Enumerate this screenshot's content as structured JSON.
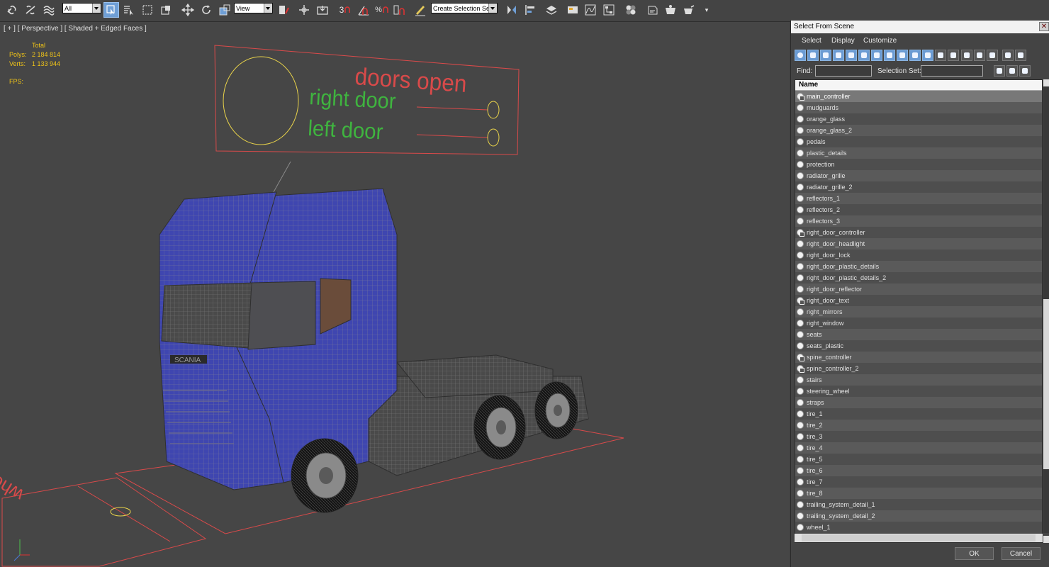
{
  "toolbar": {
    "filter_dropdown": "All",
    "ref_coord_dropdown": "View",
    "snap_labels": [
      "3",
      "%"
    ],
    "selection_set": "Create Selection Se"
  },
  "viewport": {
    "label": "[ + ] [ Perspective ] [ Shaded + Edged Faces ]",
    "stats_header": "Total",
    "polys_label": "Polys:",
    "polys_value": "2 184 814",
    "verts_label": "Verts:",
    "verts_value": "1 133 944",
    "fps_label": "FPS:",
    "annotation_doors_open": "doors open",
    "annotation_right_door": "right door",
    "annotation_left_door": "left door",
    "annotation_wheels": "wheels rotation",
    "truck_badge": "SCANIA",
    "colors": {
      "annotation_red": "#d94a4a",
      "annotation_green": "#3fb43f",
      "annotation_yellow": "#e9d34a",
      "truck_blue": "#4047b8"
    }
  },
  "dialog": {
    "title": "Select From Scene",
    "close_glyph": "✕",
    "menu": [
      "Select",
      "Display",
      "Customize"
    ],
    "find_label": "Find:",
    "selection_set_label": "Selection Set:",
    "column_header": "Name",
    "ok_label": "OK",
    "cancel_label": "Cancel",
    "rows": [
      {
        "name": "main_controller",
        "type": "controller",
        "selected": true
      },
      {
        "name": "mudguards",
        "type": "geometry"
      },
      {
        "name": "orange_glass",
        "type": "geometry"
      },
      {
        "name": "orange_glass_2",
        "type": "geometry"
      },
      {
        "name": "pedals",
        "type": "geometry"
      },
      {
        "name": "plastic_details",
        "type": "geometry"
      },
      {
        "name": "protection",
        "type": "geometry"
      },
      {
        "name": "radiator_grille",
        "type": "geometry"
      },
      {
        "name": "radiator_grille_2",
        "type": "geometry"
      },
      {
        "name": "reflectors_1",
        "type": "geometry"
      },
      {
        "name": "reflectors_2",
        "type": "geometry"
      },
      {
        "name": "reflectors_3",
        "type": "geometry"
      },
      {
        "name": "right_door_controller",
        "type": "controller"
      },
      {
        "name": "right_door_headlight",
        "type": "geometry"
      },
      {
        "name": "right_door_lock",
        "type": "geometry"
      },
      {
        "name": "right_door_plastic_details",
        "type": "geometry"
      },
      {
        "name": "right_door_plastic_details_2",
        "type": "geometry"
      },
      {
        "name": "right_door_reflector",
        "type": "geometry"
      },
      {
        "name": "right_door_text",
        "type": "controller"
      },
      {
        "name": "right_mirrors",
        "type": "geometry"
      },
      {
        "name": "right_window",
        "type": "geometry"
      },
      {
        "name": "seats",
        "type": "geometry"
      },
      {
        "name": "seats_plastic",
        "type": "geometry"
      },
      {
        "name": "spine_controller",
        "type": "controller"
      },
      {
        "name": "spine_controller_2",
        "type": "controller"
      },
      {
        "name": "stairs",
        "type": "geometry"
      },
      {
        "name": "steering_wheel",
        "type": "geometry"
      },
      {
        "name": "straps",
        "type": "geometry"
      },
      {
        "name": "tire_1",
        "type": "geometry"
      },
      {
        "name": "tire_2",
        "type": "geometry"
      },
      {
        "name": "tire_3",
        "type": "geometry"
      },
      {
        "name": "tire_4",
        "type": "geometry"
      },
      {
        "name": "tire_5",
        "type": "geometry"
      },
      {
        "name": "tire_6",
        "type": "geometry"
      },
      {
        "name": "tire_7",
        "type": "geometry"
      },
      {
        "name": "tire_8",
        "type": "geometry"
      },
      {
        "name": "trailing_system_detail_1",
        "type": "geometry"
      },
      {
        "name": "trailing_system_detail_2",
        "type": "geometry"
      },
      {
        "name": "wheel_1",
        "type": "geometry"
      }
    ]
  }
}
